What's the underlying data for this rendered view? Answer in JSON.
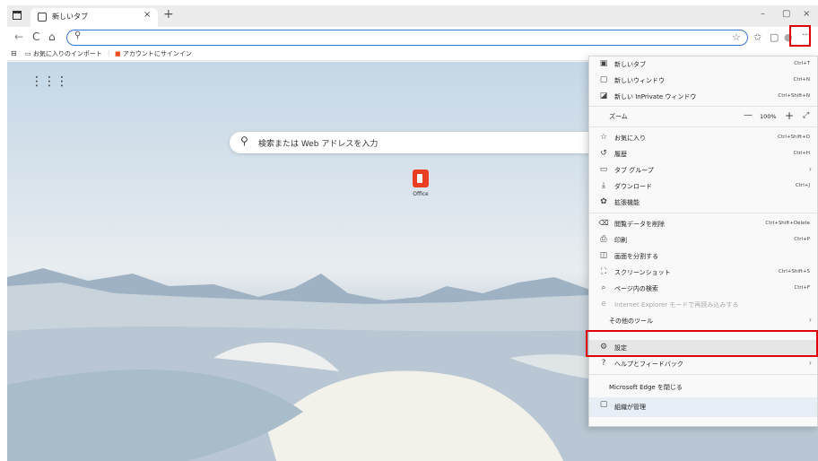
{
  "tab": {
    "title": "新しいタブ",
    "close": "×",
    "new_tab": "+"
  },
  "window_controls": {
    "minimize": "–",
    "maximize": "▢",
    "close": "×"
  },
  "toolbar": {
    "back": "←",
    "refresh": "C",
    "home": "⌂",
    "search_icon": "⚲",
    "address_value": "",
    "more": "···"
  },
  "bookmarks": [
    {
      "label": "お気に入りのインポート",
      "icon": "folder-icon"
    },
    {
      "label": "アカウントにサインイン",
      "icon": "microsoft-logo-icon"
    }
  ],
  "page": {
    "apps_icon": "⋮⋮⋮",
    "search_placeholder": "検索または Web アドレスを入力",
    "quick_link": "Office"
  },
  "menu": {
    "items": [
      {
        "label": "新しいタブ",
        "shortcut": "Ctrl+T",
        "icon": "▣"
      },
      {
        "label": "新しいウィンドウ",
        "shortcut": "Ctrl+N",
        "icon": "▢"
      },
      {
        "label": "新しい InPrivate ウィンドウ",
        "shortcut": "Ctrl+Shift+N",
        "icon": "◪"
      },
      {
        "label": "ズーム",
        "zoom": "100%"
      },
      {
        "label": "お気に入り",
        "shortcut": "Ctrl+Shift+O",
        "icon": "☆"
      },
      {
        "label": "履歴",
        "shortcut": "Ctrl+H",
        "icon": "↺"
      },
      {
        "label": "タブ グループ",
        "icon": "▭"
      },
      {
        "label": "ダウンロード",
        "shortcut": "Ctrl+J",
        "icon": "⤓"
      },
      {
        "label": "拡張機能",
        "icon": "✿"
      },
      {
        "label": "閲覧データを削除",
        "shortcut": "Ctrl+Shift+Delete",
        "icon": "🗑"
      },
      {
        "label": "印刷",
        "shortcut": "Ctrl+P",
        "icon": "⎙"
      },
      {
        "label": "画面を分割する",
        "icon": "◫"
      },
      {
        "label": "スクリーンショット",
        "shortcut": "Ctrl+Shift+S",
        "icon": "⛶"
      },
      {
        "label": "ページ内の検索",
        "shortcut": "Ctrl+F",
        "icon": "⌕"
      },
      {
        "label": "Internet Explorer モードで再読み込みする",
        "icon": "e"
      },
      {
        "label": "その他のツール"
      },
      {
        "label": "設定",
        "icon": "⚙"
      },
      {
        "label": "ヘルプとフィードバック",
        "icon": "?"
      },
      {
        "label": "Microsoft Edge を閉じる"
      },
      {
        "label": "組織が管理",
        "icon": "▢"
      }
    ]
  },
  "colors": {
    "highlight": "#e00000",
    "accent": "#3b74d8",
    "office": "#ea3e23"
  }
}
